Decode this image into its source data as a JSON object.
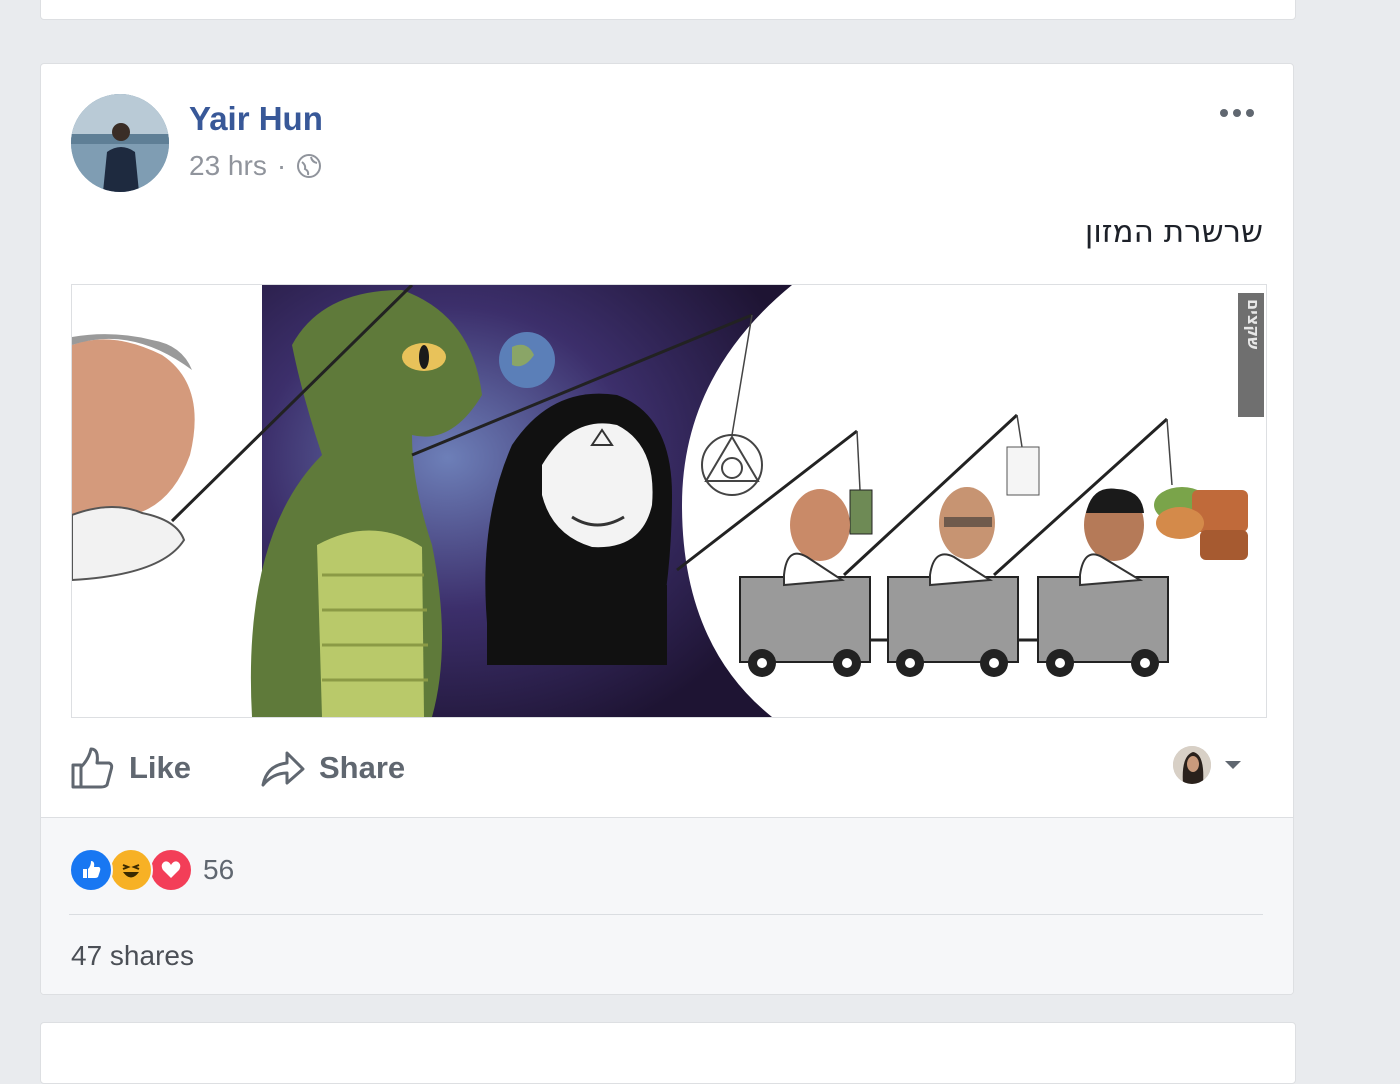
{
  "post": {
    "author": "Yair Hun",
    "timestamp": "23 hrs",
    "separator": "·",
    "privacy_icon": "globe-icon",
    "text": "שרשרת המזון",
    "more_icon": "more-icon",
    "image_watermark": "שקצים"
  },
  "actions": {
    "like_label": "Like",
    "share_label": "Share"
  },
  "footer": {
    "reaction_icons": [
      "like-reaction-icon",
      "haha-reaction-icon",
      "love-reaction-icon"
    ],
    "reaction_count": "56",
    "shares_label": "47 shares"
  },
  "colors": {
    "page_bg": "#e9ebee",
    "link_blue": "#385898",
    "like_blue": "#1877f2",
    "love_red": "#f33e58",
    "haha_yellow": "#f7b125"
  }
}
